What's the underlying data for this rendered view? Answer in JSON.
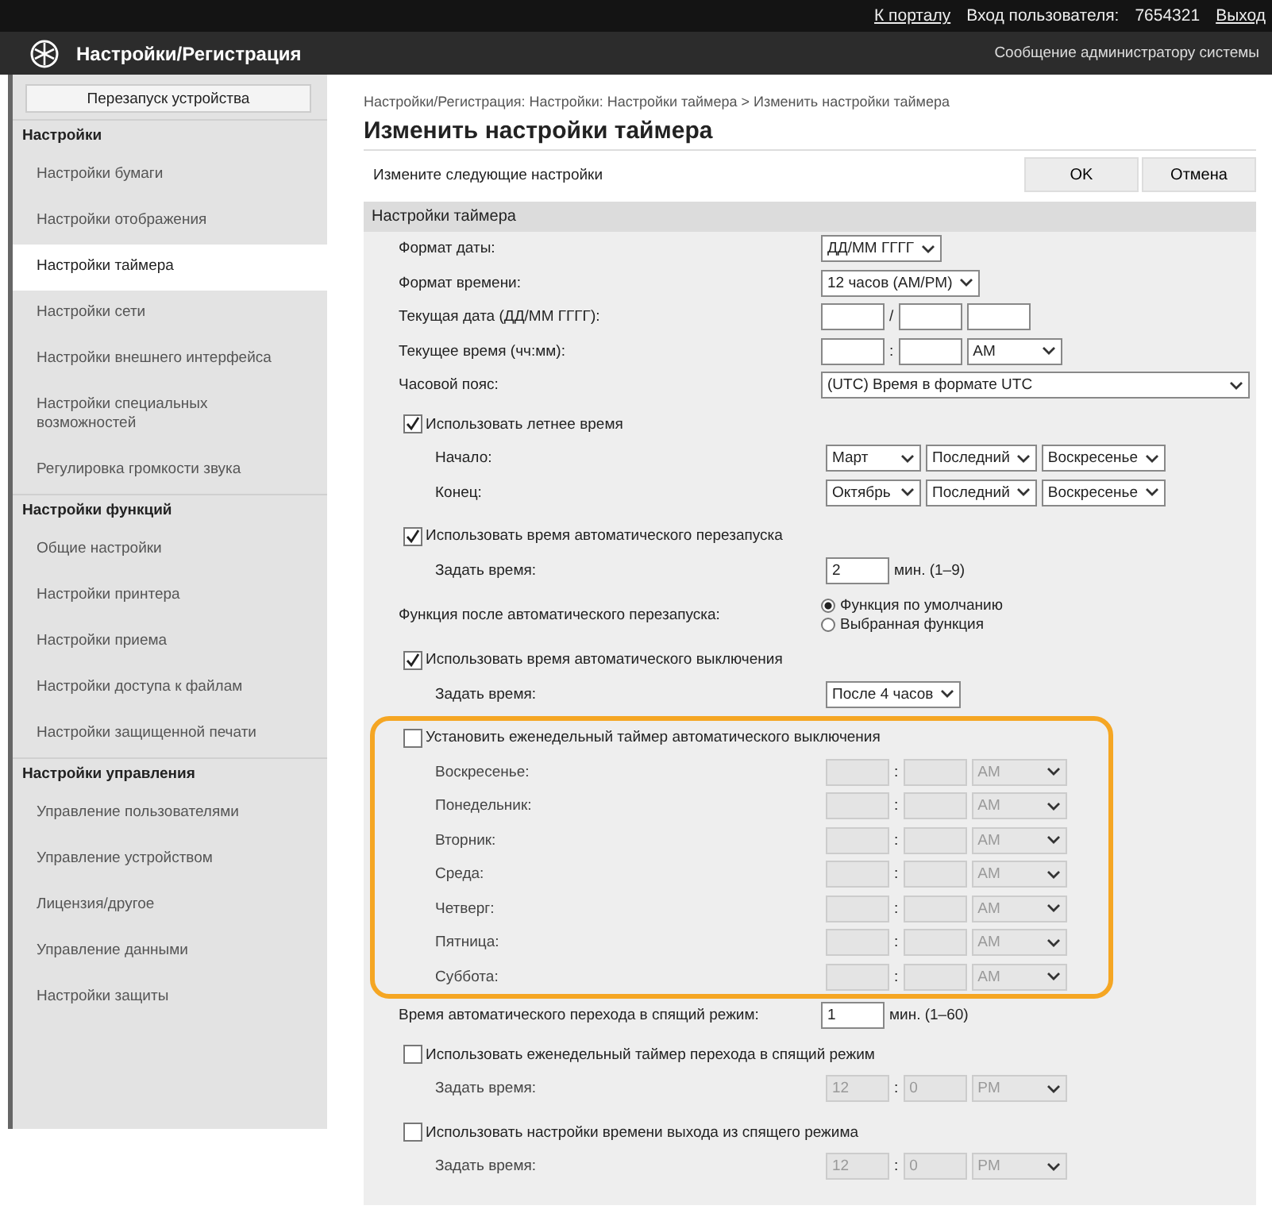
{
  "topbar": {
    "links": [
      {
        "kind": "link",
        "text": "К порталу"
      },
      {
        "kind": "text",
        "text": "Вход пользователя:"
      },
      {
        "kind": "text",
        "text": "7654321"
      },
      {
        "kind": "link",
        "text": "Выход"
      }
    ]
  },
  "header": {
    "title": "Настройки/Регистрация",
    "message_link": "Сообщение администратору системы"
  },
  "sidebar": {
    "restart_button": "Перезапуск устройства",
    "groups": [
      {
        "title": "Настройки",
        "items": [
          {
            "label": "Настройки бумаги",
            "selected": false
          },
          {
            "label": "Настройки отображения",
            "selected": false
          },
          {
            "label": "Настройки таймера",
            "selected": true
          },
          {
            "label": "Настройки сети",
            "selected": false
          },
          {
            "label": "Настройки внешнего интерфейса",
            "selected": false
          },
          {
            "label": "Настройки специальных возможностей",
            "selected": false
          },
          {
            "label": "Регулировка громкости звука",
            "selected": false
          }
        ]
      },
      {
        "title": "Настройки функций",
        "items": [
          {
            "label": "Общие настройки",
            "selected": false
          },
          {
            "label": "Настройки принтера",
            "selected": false
          },
          {
            "label": "Настройки приема",
            "selected": false
          },
          {
            "label": "Настройки доступа к файлам",
            "selected": false
          },
          {
            "label": "Настройки защищенной печати",
            "selected": false
          }
        ]
      },
      {
        "title": "Настройки управления",
        "items": [
          {
            "label": "Управление пользователями",
            "selected": false
          },
          {
            "label": "Управление устройством",
            "selected": false
          },
          {
            "label": "Лицензия/другое",
            "selected": false
          },
          {
            "label": "Управление данными",
            "selected": false
          },
          {
            "label": "Настройки защиты",
            "selected": false
          }
        ]
      }
    ]
  },
  "breadcrumb": "Настройки/Регистрация: Настройки: Настройки таймера > Изменить настройки таймера",
  "page_title": "Изменить настройки таймера",
  "instruction": "Измените следующие настройки",
  "buttons": [
    "OK",
    "Отмена"
  ],
  "section": {
    "title": "Настройки таймера",
    "rows": [
      {
        "kind": "field",
        "label": "Формат даты:",
        "disabled": false,
        "controls": [
          {
            "kind": "select",
            "value": "ДД/ММ ГГГГ"
          }
        ]
      },
      {
        "kind": "field",
        "label": "Формат времени:",
        "disabled": false,
        "controls": [
          {
            "kind": "select",
            "value": "12 часов (AM/PM)"
          }
        ]
      },
      {
        "kind": "field",
        "label": "Текущая дата (ДД/ММ ГГГГ):",
        "disabled": false,
        "controls": [
          {
            "kind": "input"
          },
          {
            "kind": "sep",
            "text": "/"
          },
          {
            "kind": "input"
          },
          {
            "kind": "input"
          }
        ]
      },
      {
        "kind": "field",
        "label": "Текущее время (чч:мм):",
        "disabled": false,
        "controls": [
          {
            "kind": "input"
          },
          {
            "kind": "sep",
            "text": ":"
          },
          {
            "kind": "input"
          },
          {
            "kind": "select",
            "value": "AM"
          }
        ]
      },
      {
        "kind": "field",
        "label": "Часовой пояс:",
        "disabled": false,
        "controls": [
          {
            "kind": "select-wide",
            "value": "(UTC) Время в формате UTC"
          }
        ]
      },
      {
        "kind": "checkbox",
        "label": "Использовать летнее время",
        "checked": true,
        "highlighted": false,
        "children": [
          {
            "kind": "field",
            "label": "Начало:",
            "disabled": false,
            "controls": [
              {
                "kind": "select",
                "value": "Март"
              },
              {
                "kind": "select",
                "value": "Последний"
              },
              {
                "kind": "select",
                "value": "Воскресенье"
              }
            ]
          },
          {
            "kind": "field",
            "label": "Конец:",
            "disabled": false,
            "controls": [
              {
                "kind": "select",
                "value": "Октябрь"
              },
              {
                "kind": "select",
                "value": "Последний"
              },
              {
                "kind": "select",
                "value": "Воскресенье"
              }
            ]
          }
        ]
      },
      {
        "kind": "checkbox",
        "label": "Использовать время автоматического перезапуска",
        "checked": true,
        "highlighted": false,
        "children": [
          {
            "kind": "field",
            "label": "Задать время:",
            "disabled": false,
            "controls": [
              {
                "kind": "input",
                "value": "2"
              },
              {
                "kind": "note",
                "text": "мин. (1–9)"
              }
            ]
          }
        ]
      },
      {
        "kind": "radio",
        "label": "Функция после автоматического перезапуска:",
        "options": [
          {
            "label": "Функция по умолчанию",
            "selected": true
          },
          {
            "label": "Выбранная функция",
            "selected": false
          }
        ]
      },
      {
        "kind": "checkbox",
        "label": "Использовать время автоматического выключения",
        "checked": true,
        "highlighted": false,
        "children": [
          {
            "kind": "field",
            "label": "Задать время:",
            "disabled": false,
            "controls": [
              {
                "kind": "select",
                "value": "После 4 часов"
              }
            ]
          }
        ]
      },
      {
        "kind": "checkbox",
        "label": "Установить еженедельный таймер автоматического выключения",
        "checked": false,
        "highlighted": true,
        "children": [
          {
            "kind": "field",
            "label": "Воскресенье:",
            "disabled": true,
            "controls": [
              {
                "kind": "input"
              },
              {
                "kind": "sep",
                "text": ":"
              },
              {
                "kind": "input"
              },
              {
                "kind": "select",
                "value": "AM"
              }
            ]
          },
          {
            "kind": "field",
            "label": "Понедельник:",
            "disabled": true,
            "controls": [
              {
                "kind": "input"
              },
              {
                "kind": "sep",
                "text": ":"
              },
              {
                "kind": "input"
              },
              {
                "kind": "select",
                "value": "AM"
              }
            ]
          },
          {
            "kind": "field",
            "label": "Вторник:",
            "disabled": true,
            "controls": [
              {
                "kind": "input"
              },
              {
                "kind": "sep",
                "text": ":"
              },
              {
                "kind": "input"
              },
              {
                "kind": "select",
                "value": "AM"
              }
            ]
          },
          {
            "kind": "field",
            "label": "Среда:",
            "disabled": true,
            "controls": [
              {
                "kind": "input"
              },
              {
                "kind": "sep",
                "text": ":"
              },
              {
                "kind": "input"
              },
              {
                "kind": "select",
                "value": "AM"
              }
            ]
          },
          {
            "kind": "field",
            "label": "Четверг:",
            "disabled": true,
            "controls": [
              {
                "kind": "input"
              },
              {
                "kind": "sep",
                "text": ":"
              },
              {
                "kind": "input"
              },
              {
                "kind": "select",
                "value": "AM"
              }
            ]
          },
          {
            "kind": "field",
            "label": "Пятница:",
            "disabled": true,
            "controls": [
              {
                "kind": "input"
              },
              {
                "kind": "sep",
                "text": ":"
              },
              {
                "kind": "input"
              },
              {
                "kind": "select",
                "value": "AM"
              }
            ]
          },
          {
            "kind": "field",
            "label": "Суббота:",
            "disabled": true,
            "controls": [
              {
                "kind": "input"
              },
              {
                "kind": "sep",
                "text": ":"
              },
              {
                "kind": "input"
              },
              {
                "kind": "select",
                "value": "AM"
              }
            ]
          }
        ]
      },
      {
        "kind": "field",
        "label": "Время автоматического перехода в спящий режим:",
        "disabled": false,
        "controls": [
          {
            "kind": "input",
            "value": "1"
          },
          {
            "kind": "note",
            "text": "мин. (1–60)"
          }
        ]
      },
      {
        "kind": "checkbox",
        "label": "Использовать еженедельный таймер перехода в спящий режим",
        "checked": false,
        "highlighted": false,
        "children": [
          {
            "kind": "field",
            "label": "Задать время:",
            "disabled": true,
            "controls": [
              {
                "kind": "input",
                "value": "12"
              },
              {
                "kind": "sep",
                "text": ":"
              },
              {
                "kind": "input",
                "value": "0"
              },
              {
                "kind": "select",
                "value": "PM"
              }
            ]
          }
        ]
      },
      {
        "kind": "checkbox",
        "label": "Использовать настройки времени выхода из спящего режима",
        "checked": false,
        "highlighted": false,
        "children": [
          {
            "kind": "field",
            "label": "Задать время:",
            "disabled": true,
            "controls": [
              {
                "kind": "input",
                "value": "12"
              },
              {
                "kind": "sep",
                "text": ":"
              },
              {
                "kind": "input",
                "value": "0"
              },
              {
                "kind": "select",
                "value": "PM"
              }
            ]
          }
        ]
      }
    ]
  }
}
